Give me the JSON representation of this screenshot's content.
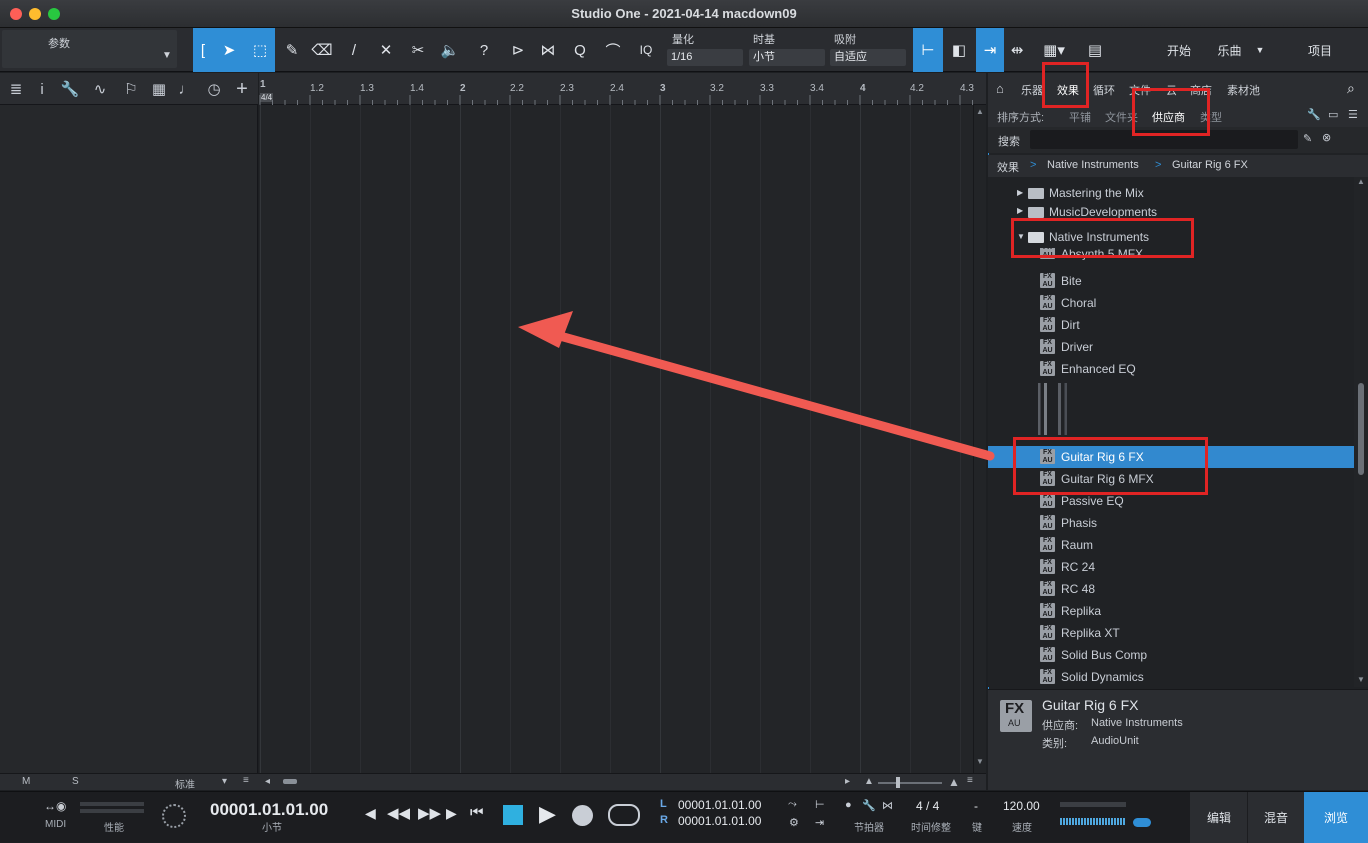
{
  "window": {
    "title": "Studio One - 2021-04-14 macdown09"
  },
  "toolbar": {
    "params_label": "参数",
    "quantize_label": "量化",
    "quantize_value": "1/16",
    "timebase_label": "时基",
    "timebase_value": "小节",
    "snap_label": "吸附",
    "snap_value": "自适应",
    "iq_label": "IQ",
    "start_label": "开始",
    "song_label": "乐曲",
    "project_label": "项目"
  },
  "ruler": {
    "time_sig": "4/4",
    "ticks": [
      "1",
      "1.2",
      "1.3",
      "1.4",
      "2",
      "2.2",
      "2.3",
      "2.4",
      "3",
      "3.2",
      "3.3",
      "3.4",
      "4",
      "4.2",
      "4.3"
    ]
  },
  "bottom_strip": {
    "m": "M",
    "s": "S",
    "preset": "标准"
  },
  "browser": {
    "tabs": [
      "乐器",
      "效果",
      "循环",
      "文件",
      "云",
      "商店",
      "素材池"
    ],
    "sort_label": "排序方式:",
    "sort_options": [
      "平铺",
      "文件夹",
      "供应商",
      "类型"
    ],
    "search_label": "搜索",
    "breadcrumb": [
      "效果",
      "Native Instruments",
      "Guitar Rig 6 FX"
    ],
    "folders": [
      "Mastering the Mix",
      "MusicDevelopments",
      "Native Instruments"
    ],
    "plugins": [
      "Absynth 5 MFX",
      "Bite",
      "Choral",
      "Dirt",
      "Driver",
      "Enhanced EQ",
      "Guitar Rig 6 FX",
      "Guitar Rig 6 MFX",
      "Passive EQ",
      "Phasis",
      "Raum",
      "RC 24",
      "RC 48",
      "Replika",
      "Replika XT",
      "Solid Bus Comp",
      "Solid Dynamics"
    ],
    "selected": "Guitar Rig 6 FX",
    "fx_badge": "FX",
    "au_badge": "AU"
  },
  "info": {
    "name": "Guitar Rig 6 FX",
    "vendor_label": "供应商:",
    "vendor": "Native Instruments",
    "category_label": "类别:",
    "category": "AudioUnit"
  },
  "transport": {
    "midi": "MIDI",
    "perf": "性能",
    "position": "00001.01.01.00",
    "position_unit": "小节",
    "loop_l": "00001.01.01.00",
    "loop_r": "00001.01.01.00",
    "L": "L",
    "R": "R",
    "metronome": "节拍器",
    "timesig": "4 / 4",
    "timesig_label": "时间修整",
    "key": "-",
    "key_label": "键",
    "tempo": "120.00",
    "tempo_label": "速度",
    "edit": "编辑",
    "mix": "混音",
    "browse": "浏览"
  },
  "colors": {
    "accent": "#2f8ed6",
    "highlight": "#e02424",
    "arrow": "#f05a52"
  }
}
